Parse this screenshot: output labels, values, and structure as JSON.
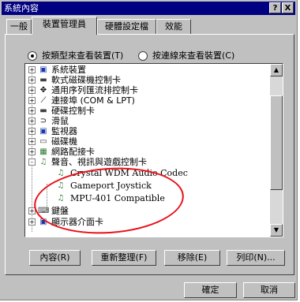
{
  "window": {
    "title": "系統內容",
    "help_button": "?",
    "close_button": "X"
  },
  "tabs": [
    {
      "label": "一般"
    },
    {
      "label": "裝置管理員"
    },
    {
      "label": "硬體設定檔"
    },
    {
      "label": "效能"
    }
  ],
  "view_options": {
    "by_type": "按類型來查看裝置(T)",
    "by_connection": "按連線來查看裝置(C)",
    "selected": "by_type"
  },
  "tree": {
    "items": [
      {
        "label": "系統裝置",
        "icon": "computer-icon",
        "expand": "+"
      },
      {
        "label": "軟式磁碟機控制卡",
        "icon": "floppy-controller-icon",
        "expand": "+"
      },
      {
        "label": "通用序列匯流排控制卡",
        "icon": "usb-icon",
        "expand": "+"
      },
      {
        "label": "連接埠 (COM & LPT)",
        "icon": "port-icon",
        "expand": "+"
      },
      {
        "label": "硬碟控制卡",
        "icon": "disk-controller-icon",
        "expand": "+"
      },
      {
        "label": "滑鼠",
        "icon": "mouse-icon",
        "expand": "+"
      },
      {
        "label": "監視器",
        "icon": "monitor-icon",
        "expand": "+"
      },
      {
        "label": "磁碟機",
        "icon": "disk-drive-icon",
        "expand": "+"
      },
      {
        "label": "網路配接卡",
        "icon": "network-card-icon",
        "expand": "+"
      },
      {
        "label": "聲音、視訊與遊戲控制卡",
        "icon": "sound-icon",
        "expand": "-"
      }
    ],
    "children": [
      {
        "label": "Crystal WDM Audio Codec",
        "icon": "sound-device-icon"
      },
      {
        "label": "Gameport Joystick",
        "icon": "sound-device-icon"
      },
      {
        "label": "MPU-401 Compatible",
        "icon": "sound-device-icon"
      }
    ],
    "after": [
      {
        "label": "鍵盤",
        "icon": "keyboard-icon",
        "expand": "+"
      },
      {
        "label": "顯示器介面卡",
        "icon": "display-adapter-icon",
        "expand": "+"
      }
    ]
  },
  "action_buttons": {
    "properties": "內容(R)",
    "refresh": "重新整理(F)",
    "remove": "移除(E)",
    "print": "列印(N)..."
  },
  "dialog_buttons": {
    "ok": "確定",
    "cancel": "取消"
  },
  "colors": {
    "titlebar": "#000080",
    "annotation_circle": "#e8101a"
  }
}
